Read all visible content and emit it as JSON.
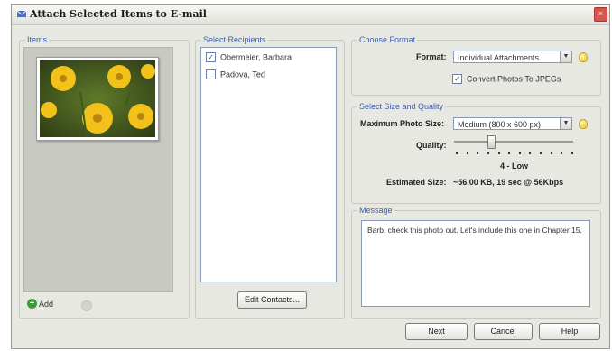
{
  "window": {
    "title": "Attach Selected Items to E-mail",
    "close_glyph": "×"
  },
  "items": {
    "label": "Items",
    "add_label": "Add"
  },
  "recipients": {
    "label": "Select Recipients",
    "list": [
      {
        "name": "Obermeier, Barbara",
        "checked": true
      },
      {
        "name": "Padova, Ted",
        "checked": false
      }
    ],
    "edit_button": "Edit Contacts..."
  },
  "format": {
    "label": "Choose Format",
    "format_label": "Format:",
    "format_value": "Individual Attachments",
    "convert_label": "Convert Photos To JPEGs",
    "convert_checked": true
  },
  "size": {
    "label": "Select Size and Quality",
    "max_size_label": "Maximum Photo Size:",
    "max_size_value": "Medium (800 x 600 px)",
    "quality_label": "Quality:",
    "quality_value": "4 - Low",
    "quality_level": 4,
    "quality_max": 12,
    "estimated_label": "Estimated Size:",
    "estimated_value": "~56.00 KB, 19 sec @ 56Kbps"
  },
  "message": {
    "label": "Message",
    "text": "Barb, check this photo out. Let's include this one in Chapter 15."
  },
  "buttons": {
    "next": "Next",
    "cancel": "Cancel",
    "help": "Help"
  },
  "icons": {
    "title": "email-attach-icon",
    "add": "add-plus-icon",
    "remove": "remove-icon",
    "hint": "lightbulb-icon",
    "dropdown": "chevron-down-icon"
  }
}
